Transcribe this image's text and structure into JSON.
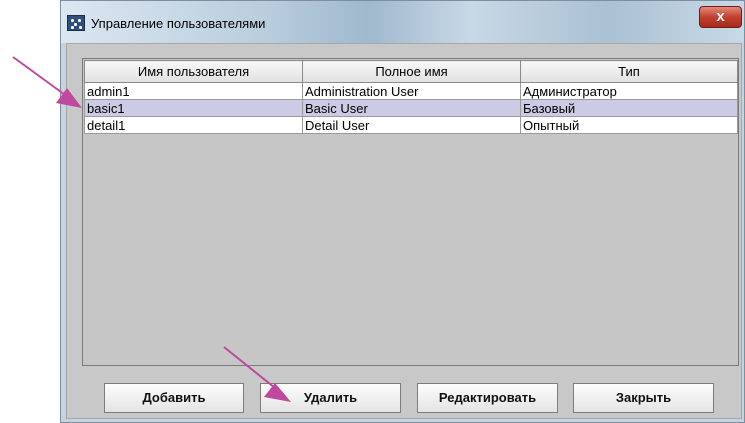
{
  "window": {
    "title": "Управление пользователями",
    "close_glyph": "x"
  },
  "table": {
    "columns": [
      "Имя пользователя",
      "Полное имя",
      "Тип"
    ],
    "rows": [
      {
        "username": "admin1",
        "full_name": "Administration User",
        "type": "Администратор",
        "selected": false
      },
      {
        "username": "basic1",
        "full_name": "Basic User",
        "type": "Базовый",
        "selected": true
      },
      {
        "username": "detail1",
        "full_name": "Detail User",
        "type": "Опытный",
        "selected": false
      }
    ]
  },
  "buttons": {
    "add": "Добавить",
    "delete": "Удалить",
    "edit": "Редактировать",
    "close": "Закрыть"
  },
  "colors": {
    "accent_arrow": "#c0489e",
    "selection": "#cccbe6"
  }
}
